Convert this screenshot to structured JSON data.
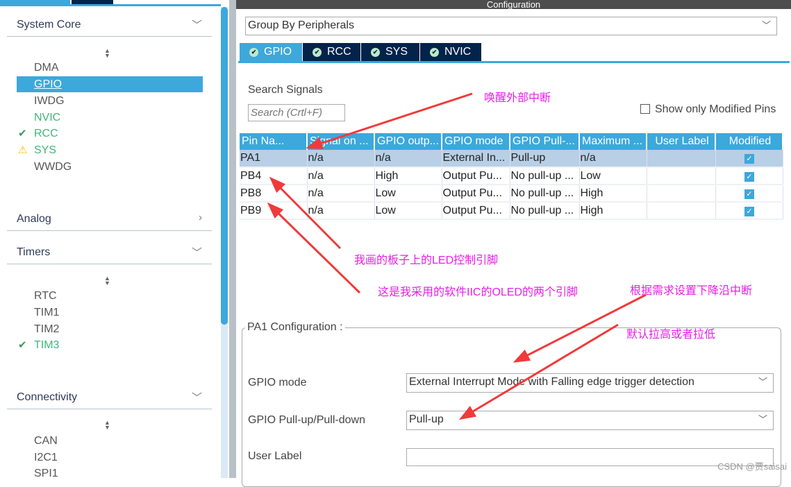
{
  "sidebar": {
    "system_core": {
      "label": "System Core",
      "items": [
        {
          "label": "DMA",
          "status": "none"
        },
        {
          "label": "GPIO",
          "status": "selected"
        },
        {
          "label": "IWDG",
          "status": "none"
        },
        {
          "label": "NVIC",
          "status": "configured"
        },
        {
          "label": "RCC",
          "status": "ok"
        },
        {
          "label": "SYS",
          "status": "warning"
        },
        {
          "label": "WWDG",
          "status": "none"
        }
      ]
    },
    "analog": {
      "label": "Analog"
    },
    "timers": {
      "label": "Timers",
      "items": [
        {
          "label": "RTC"
        },
        {
          "label": "TIM1"
        },
        {
          "label": "TIM2"
        },
        {
          "label": "TIM3",
          "status": "ok"
        }
      ]
    },
    "connectivity": {
      "label": "Connectivity",
      "items": [
        {
          "label": "CAN"
        },
        {
          "label": "I2C1"
        },
        {
          "label": "SPI1"
        }
      ]
    }
  },
  "config": {
    "header": "Configuration",
    "group_by": "Group By Peripherals",
    "tabs": [
      "GPIO",
      "RCC",
      "SYS",
      "NVIC"
    ],
    "search_label": "Search Signals",
    "search_placeholder": "Search (Crtl+F)",
    "show_modified": "Show only Modified Pins",
    "columns": [
      "Pin Na...",
      "Signal on ...",
      "GPIO outp...",
      "GPIO mode",
      "GPIO Pull-...",
      "Maximum ...",
      "User Label",
      "Modified"
    ],
    "rows": [
      [
        "PA1",
        "n/a",
        "n/a",
        "External In...",
        "Pull-up",
        "n/a",
        "",
        true
      ],
      [
        "PB4",
        "n/a",
        "High",
        "Output Pu...",
        "No pull-up ...",
        "Low",
        "",
        true
      ],
      [
        "PB8",
        "n/a",
        "Low",
        "Output Pu...",
        "No pull-up ...",
        "High",
        "",
        true
      ],
      [
        "PB9",
        "n/a",
        "Low",
        "Output Pu...",
        "No pull-up ...",
        "High",
        "",
        true
      ]
    ],
    "pin_config": {
      "title": "PA1 Configuration :",
      "gpio_mode_label": "GPIO mode",
      "gpio_mode_value": "External Interrupt Mode with Falling edge trigger detection",
      "pull_label": "GPIO Pull-up/Pull-down",
      "pull_value": "Pull-up",
      "user_label_label": "User Label",
      "user_label_value": ""
    }
  },
  "annotations": [
    "唤醒外部中断",
    "我画的板子上的LED控制引脚",
    "这是我采用的软件IIC的OLED的两个引脚",
    "根据需求设置下降沿中断",
    "默认拉高或者拉低"
  ],
  "watermark": "CSDN @贾saisai",
  "colors": {
    "accent": "#3ca8dc",
    "tab_dark": "#03234b",
    "annotation": "#e81ee8",
    "arrow": "#f03a3a",
    "ok": "#3db87a"
  }
}
